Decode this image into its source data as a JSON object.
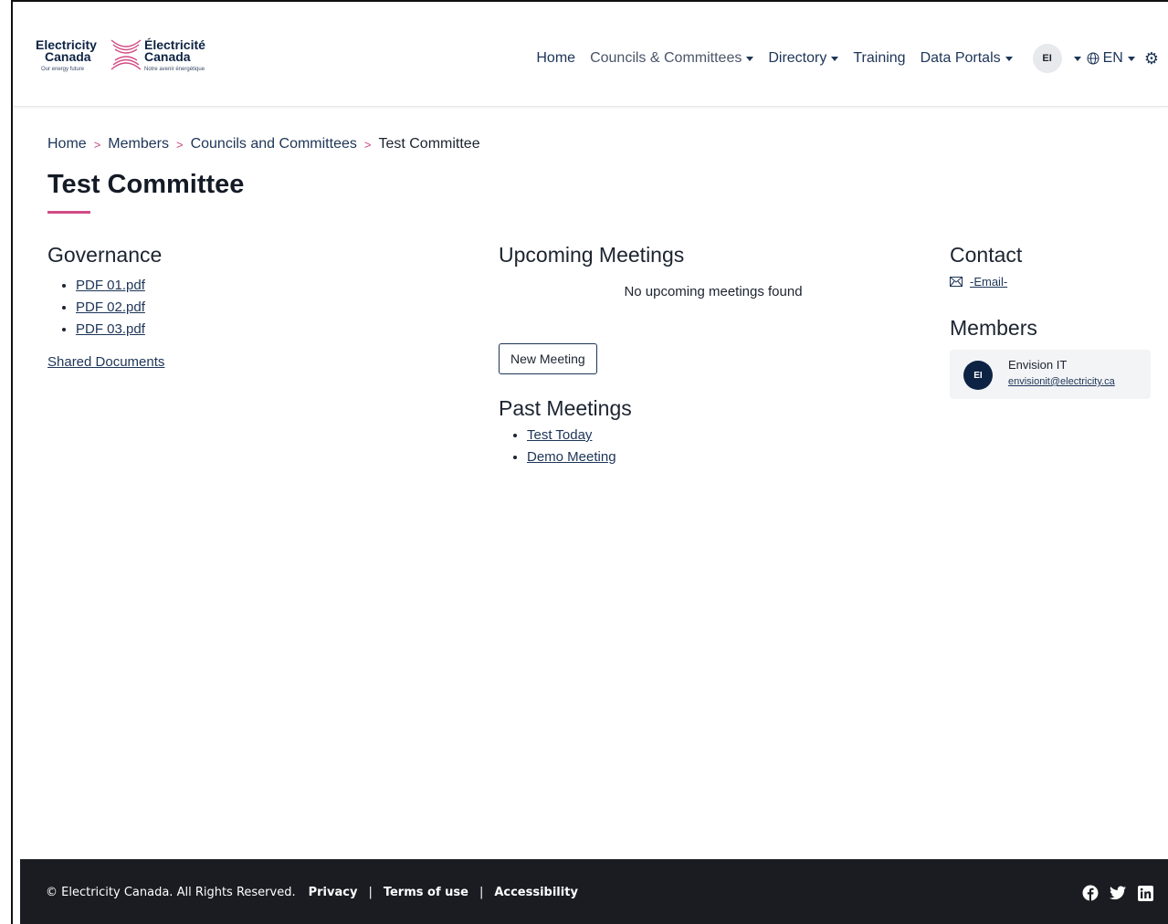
{
  "brand": {
    "name_en_1": "Electricity",
    "name_en_2": "Canada",
    "name_fr_1": "Électricité",
    "name_fr_2": "Canada",
    "tagline_en": "Our energy future",
    "tagline_fr": "Notre avenir énergétique",
    "accent_color": "#d24b86",
    "navy_color": "#0d2344"
  },
  "nav": {
    "home": "Home",
    "councils": "Councils & Committees",
    "directory": "Directory",
    "training": "Training",
    "data_portals": "Data Portals",
    "user_initials": "EI",
    "language": "EN",
    "settings_icon": "gear-icon",
    "globe_icon": "globe-icon"
  },
  "breadcrumb": {
    "items": [
      "Home",
      "Members",
      "Councils and Committees"
    ],
    "current": "Test Committee",
    "separator": ">"
  },
  "page": {
    "title": "Test Committee"
  },
  "governance": {
    "heading": "Governance",
    "documents": [
      "PDF 01.pdf",
      "PDF 02.pdf",
      "PDF 03.pdf"
    ],
    "shared_documents": "Shared Documents"
  },
  "meetings": {
    "upcoming_heading": "Upcoming Meetings",
    "no_upcoming": "No upcoming meetings found",
    "new_meeting_button": "New Meeting",
    "past_heading": "Past Meetings",
    "past": [
      "Test Today",
      "Demo Meeting"
    ]
  },
  "contact": {
    "heading": "Contact",
    "email_label": "-Email-",
    "email_icon": "mail-icon"
  },
  "members": {
    "heading": "Members",
    "list": [
      {
        "initials": "EI",
        "name": "Envision IT",
        "email": "envisionit@electricity.ca"
      }
    ]
  },
  "footer": {
    "copyright": "© Electricity Canada. All Rights Reserved.",
    "privacy": "Privacy",
    "terms": "Terms of use",
    "accessibility": "Accessibility",
    "separator": "|",
    "social_icons": [
      "facebook-icon",
      "twitter-icon",
      "linkedin-icon"
    ],
    "background": "#1a1c22"
  }
}
